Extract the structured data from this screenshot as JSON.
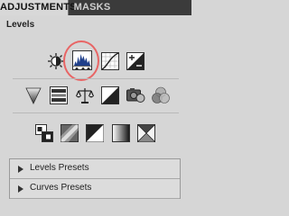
{
  "tabs": {
    "adjustments": "ADJUSTMENTS",
    "masks": "MASKS"
  },
  "panel": {
    "heading": "Levels"
  },
  "presets": [
    {
      "label": "Levels Presets"
    },
    {
      "label": "Curves Presets"
    }
  ],
  "colors": {
    "highlight": "#e86565",
    "panel_bg": "#d6d6d6",
    "tabbar_bg": "#3b3b3b"
  },
  "icons": {
    "row1": [
      "brightness-contrast-icon",
      "levels-icon",
      "curves-icon",
      "exposure-icon"
    ],
    "row2": [
      "vibrance-icon",
      "hue-saturation-icon",
      "color-balance-icon",
      "black-white-icon",
      "photo-filter-icon",
      "channel-mixer-icon"
    ],
    "row3": [
      "invert-icon",
      "posterize-icon",
      "threshold-icon",
      "gradient-map-icon",
      "selective-color-icon"
    ]
  }
}
